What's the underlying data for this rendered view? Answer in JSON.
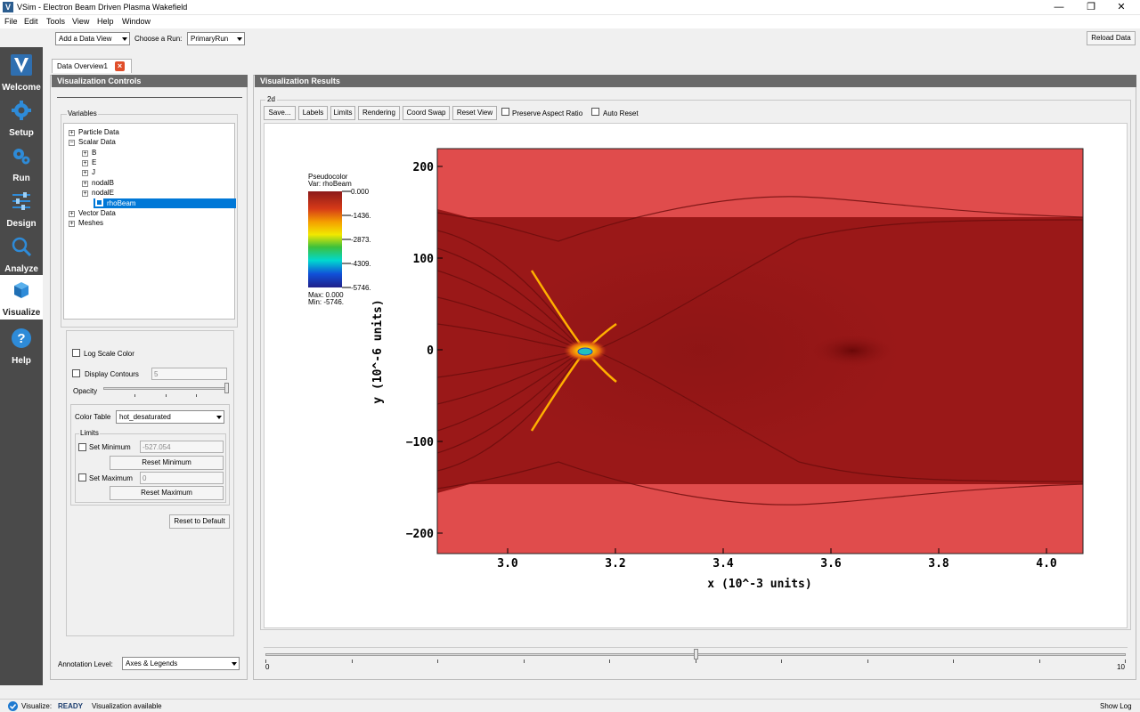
{
  "window": {
    "title": "VSim - Electron Beam Driven Plasma Wakefield",
    "app_icon": "V"
  },
  "menu": [
    "File",
    "Edit",
    "Tools",
    "View",
    "Help",
    "Window"
  ],
  "sidebar": [
    {
      "label": "Welcome",
      "icon": "vsim-logo-icon"
    },
    {
      "label": "Setup",
      "icon": "gear-icon"
    },
    {
      "label": "Run",
      "icon": "gears-icon"
    },
    {
      "label": "Design",
      "icon": "sliders-icon"
    },
    {
      "label": "Analyze",
      "icon": "magnifier-icon"
    },
    {
      "label": "Visualize",
      "icon": "cube-icon"
    },
    {
      "label": "Help",
      "icon": "question-icon"
    }
  ],
  "toolbar": {
    "add_view": "Add a Data View",
    "choose_run_label": "Choose a Run:",
    "run_value": "PrimaryRun",
    "reload": "Reload Data"
  },
  "tab": {
    "label": "Data Overview1",
    "close": "×"
  },
  "controls": {
    "header": "Visualization Controls",
    "variables_label": "Variables",
    "tree": [
      {
        "label": "Particle Data",
        "expander": "+",
        "level": 0
      },
      {
        "label": "Scalar Data",
        "expander": "−",
        "level": 0
      },
      {
        "label": "B",
        "expander": "+",
        "level": 1
      },
      {
        "label": "E",
        "expander": "+",
        "level": 1
      },
      {
        "label": "J",
        "expander": "+",
        "level": 1
      },
      {
        "label": "nodalB",
        "expander": "+",
        "level": 1
      },
      {
        "label": "nodalE",
        "expander": "+",
        "level": 1
      },
      {
        "label": "rhoBeam",
        "expander": "",
        "level": 2
      },
      {
        "label": "Vector Data",
        "expander": "+",
        "level": 0
      },
      {
        "label": "Meshes",
        "expander": "+",
        "level": 0
      }
    ],
    "log_scale": "Log Scale Color",
    "display_contours": "Display Contours",
    "contours_value": "5",
    "opacity": "Opacity",
    "color_table_label": "Color Table",
    "color_table_value": "hot_desaturated",
    "limits_label": "Limits",
    "set_min": "Set Minimum",
    "min_value": "-527.054",
    "reset_min": "Reset Minimum",
    "set_max": "Set Maximum",
    "max_value": "0",
    "reset_max": "Reset Maximum",
    "reset_default": "Reset to Default",
    "annotation_label": "Annotation Level:",
    "annotation_value": "Axes & Legends"
  },
  "results": {
    "header": "Visualization Results",
    "group": "2d",
    "buttons": [
      "Save...",
      "Labels",
      "Limits",
      "Rendering",
      "Coord Swap",
      "Reset View"
    ],
    "preserve_aspect": "Preserve Aspect Ratio",
    "auto_reset": "Auto Reset",
    "slider_min": "0",
    "slider_max": "10",
    "slider_value": 5
  },
  "plot": {
    "legend_title": "Pseudocolor",
    "legend_var": "Var: rhoBeam",
    "legend_ticks": [
      "0.000",
      "-1436.",
      "-2873.",
      "-4309.",
      "-5746."
    ],
    "legend_max": "Max:  0.000",
    "legend_min": "Min: -5746.",
    "xlabel": "x (10^-3 units)",
    "ylabel": "y (10^-6 units)",
    "xticks": [
      "3.0",
      "3.2",
      "3.4",
      "3.6",
      "3.8",
      "4.0"
    ],
    "yticks": [
      "200",
      "100",
      "0",
      "−100",
      "−200"
    ]
  },
  "status": {
    "label": "Visualize:",
    "state": "READY",
    "message": "Visualization available",
    "show_log": "Show Log"
  },
  "colors": {
    "sidebar": "#4a4a4a",
    "panel_header": "#6a6a6a",
    "plasma_light": "#e04a4a",
    "plasma_dark": "#9a1818",
    "selection": "#0078d7"
  }
}
